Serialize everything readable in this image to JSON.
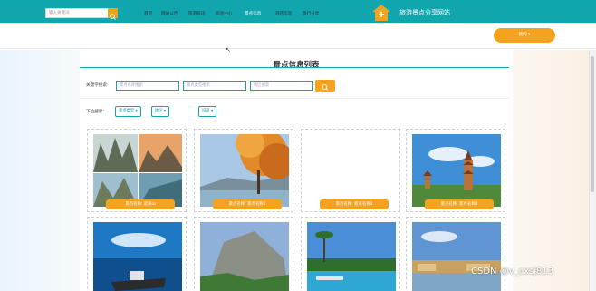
{
  "header": {
    "search_placeholder": "输入关键词",
    "site_title": "旅游景点分享网站"
  },
  "nav": {
    "items": [
      {
        "label": "首页"
      },
      {
        "label": "网站公告"
      },
      {
        "label": "旅游资讯"
      },
      {
        "label": "商品中心"
      },
      {
        "label": "景点信息"
      },
      {
        "label": "酒店信息"
      },
      {
        "label": "旅行分享"
      }
    ],
    "active_index": 4,
    "user_label": "我的 ▾"
  },
  "main": {
    "title": "景点信息列表",
    "keyword_label": "关键字搜索:",
    "keyword_inputs": [
      "景点名称搜索",
      "景点类型搜索",
      "地区搜索"
    ],
    "dropdown_label": "下拉搜索:",
    "dropdowns": [
      "景点类型 ▾",
      "地区 ▾",
      "排序 ▾"
    ],
    "cards": [
      {
        "name": "景点名称: 武夷山"
      },
      {
        "name": "景点名称: 景点名称2"
      },
      {
        "name": "景点名称: 景点名称3"
      },
      {
        "name": "景点名称: 景点名称4"
      },
      {
        "name": ""
      },
      {
        "name": ""
      },
      {
        "name": ""
      },
      {
        "name": ""
      }
    ]
  },
  "watermark": "CSDN @v_cxsj813",
  "colors": {
    "teal": "#11a5ad",
    "orange": "#f5a31f"
  }
}
